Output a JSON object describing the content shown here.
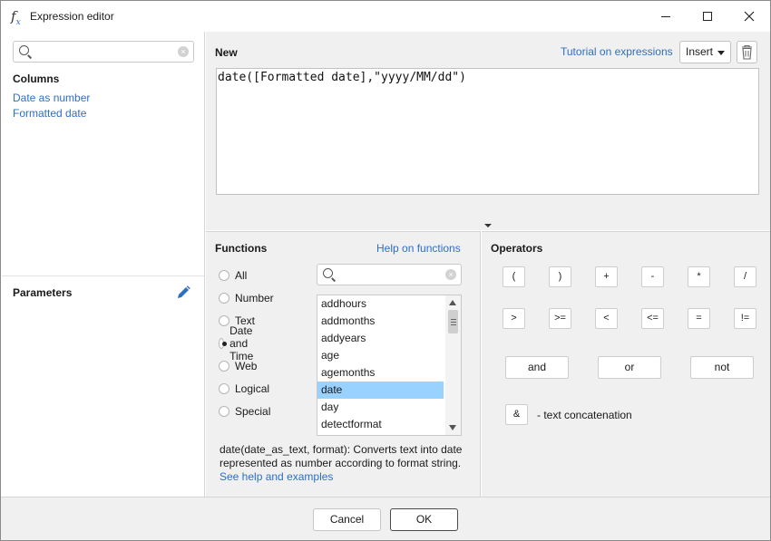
{
  "window": {
    "title": "Expression editor",
    "icon_glyph": "f",
    "icon_sub": "x"
  },
  "left": {
    "search_placeholder": "",
    "columns_title": "Columns",
    "columns": [
      "Date as number",
      "Formatted date"
    ],
    "parameters_title": "Parameters"
  },
  "editor": {
    "title": "New",
    "tutorial_link": "Tutorial on expressions",
    "insert_label": "Insert",
    "expression": "date([Formatted date],\"yyyy/MM/dd\")"
  },
  "functions": {
    "title": "Functions",
    "help_link": "Help on functions",
    "categories": [
      "All",
      "Number",
      "Text",
      "Date and Time",
      "Web",
      "Logical",
      "Special"
    ],
    "selected_category": "Date and Time",
    "items": [
      "addhours",
      "addmonths",
      "addyears",
      "age",
      "agemonths",
      "date",
      "day",
      "detectformat"
    ],
    "selected_item": "date",
    "description": "date(date_as_text, format): Converts text into date represented as number according to format string.",
    "examples_link": "See help and examples"
  },
  "operators": {
    "title": "Operators",
    "row1": [
      "(",
      ")",
      "+",
      "-",
      "*",
      "/"
    ],
    "row2": [
      ">",
      ">=",
      "<",
      "<=",
      "=",
      "!="
    ],
    "logical": [
      "and",
      "or",
      "not"
    ],
    "concat_symbol": "&",
    "concat_label": "- text concatenation"
  },
  "footer": {
    "cancel_label": "Cancel",
    "ok_label": "OK"
  }
}
